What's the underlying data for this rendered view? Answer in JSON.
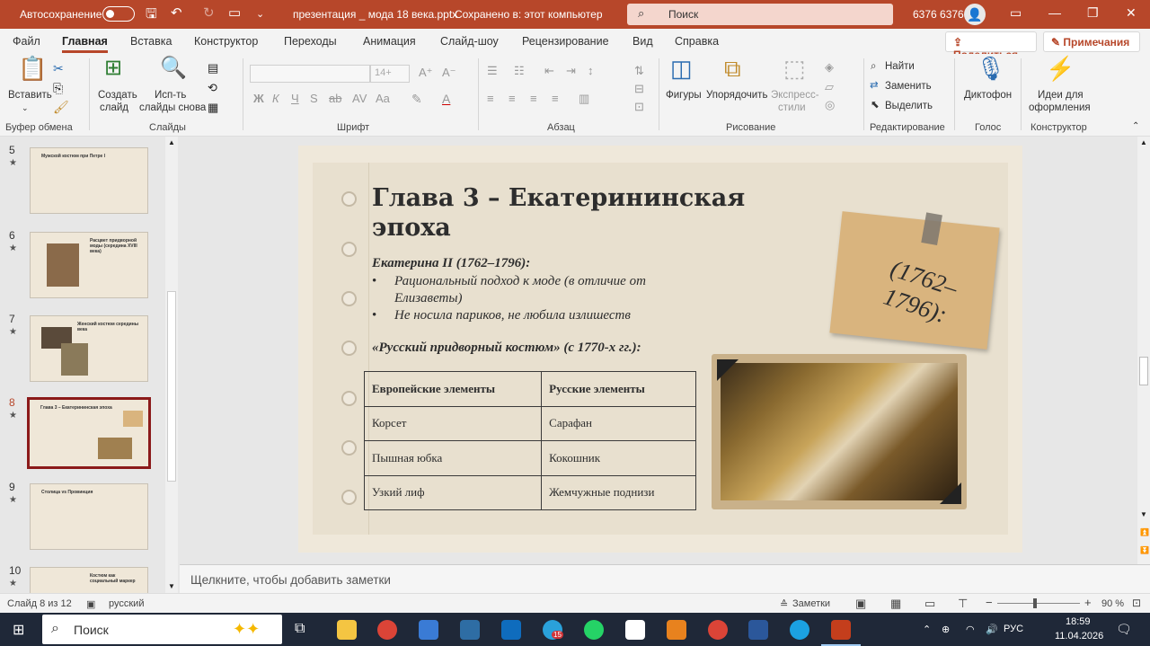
{
  "titlebar": {
    "autosave_label": "Автосохранение",
    "autosave_state": "off",
    "filename": "презентация _ мода 18 века.pptx",
    "save_status": "Сохранено в: этот компьютер",
    "search_placeholder": "Поиск",
    "user": "6376 6376",
    "color": "#b7472a"
  },
  "tabs": [
    "Файл",
    "Главная",
    "Вставка",
    "Конструктор",
    "Переходы",
    "Анимация",
    "Слайд-шоу",
    "Рецензирование",
    "Вид",
    "Справка"
  ],
  "active_tab": "Главная",
  "share_label": "Поделиться",
  "comments_label": "Примечания",
  "ribbon": {
    "paste": "Вставить",
    "new_slide_1": "Создать",
    "new_slide_2": "слайд",
    "reuse_1": "Исп-ть",
    "reuse_2": "слайды снова",
    "font_size": "14+",
    "shapes": "Фигуры",
    "arrange": "Упорядочить",
    "express_1": "Экспресс-",
    "express_2": "стили",
    "find": "Найти",
    "replace": "Заменить",
    "select": "Выделить",
    "dictate": "Диктофон",
    "ideas_1": "Идеи для",
    "ideas_2": "оформления",
    "groups": {
      "clipboard": "Буфер обмена",
      "slides": "Слайды",
      "font": "Шрифт",
      "paragraph": "Абзац",
      "drawing": "Рисование",
      "editing": "Редактирование",
      "voice": "Голос",
      "designer": "Конструктор"
    }
  },
  "thumbnails": [
    {
      "num": "5",
      "title": "Мужской костюм при Петре I"
    },
    {
      "num": "6",
      "title": "Расцвет придворной моды (середина XVIII века)"
    },
    {
      "num": "7",
      "title": "Женский костюм середины века"
    },
    {
      "num": "8",
      "title": "Глава 3 – Екатерининская эпоха"
    },
    {
      "num": "9",
      "title": "Столица vs Провинция"
    },
    {
      "num": "10",
      "title": "Костюм как социальный маркер"
    }
  ],
  "slide": {
    "title": "Глава 3 – Екатерининская эпоха",
    "subheading": "Екатерина II (1762–1796):",
    "bullets": [
      "Рациональный подход к моде (в отличие от Елизаветы)",
      "Не носила париков, не любила излишеств"
    ],
    "section": "«Русский придворный костюм» (с 1770-х гг.):",
    "table": {
      "headers": [
        "Европейские элементы",
        "Русские элементы"
      ],
      "rows": [
        [
          "Корсет",
          "Сарафан"
        ],
        [
          "Пышная юбка",
          "Кокошник"
        ],
        [
          "Узкий лиф",
          "Жемчужные поднизи"
        ]
      ]
    },
    "note_text": "(1762–1796):"
  },
  "notes_placeholder": "Щелкните, чтобы добавить заметки",
  "status": {
    "slide_counter": "Слайд 8 из 12",
    "language": "русский",
    "notes_button": "Заметки",
    "zoom": "90 %"
  },
  "taskbar": {
    "search": "Поиск",
    "lang": "РУС",
    "time": "18:59",
    "date": "11.04.2026",
    "telegram_badge": "15"
  }
}
